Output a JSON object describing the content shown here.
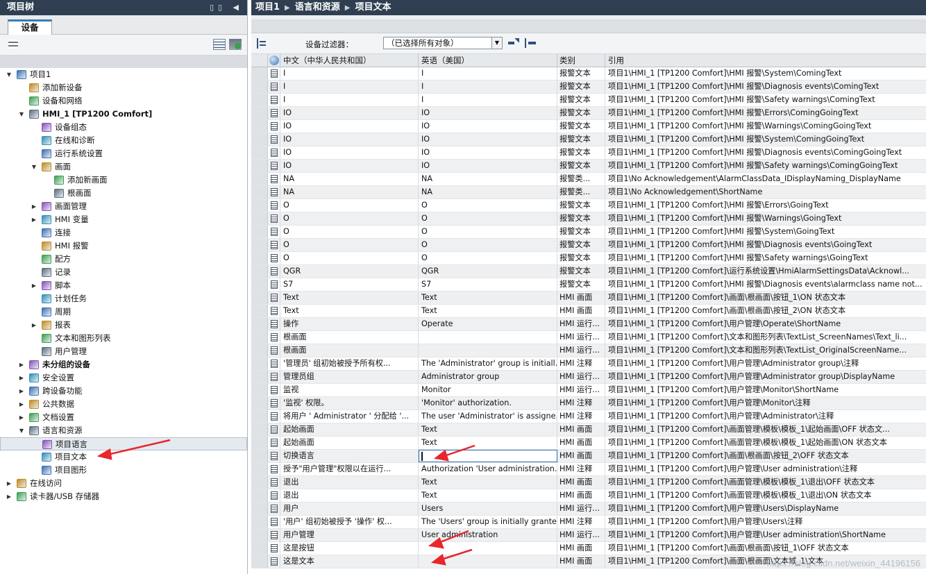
{
  "left_panel": {
    "title": "项目树",
    "tab": "设备",
    "tree": [
      {
        "label": "项目1",
        "level": 0,
        "arrow": "down",
        "icon": "project-icon",
        "bold": false
      },
      {
        "label": "添加新设备",
        "level": 1,
        "arrow": "",
        "icon": "add-device-icon",
        "bold": false
      },
      {
        "label": "设备和网络",
        "level": 1,
        "arrow": "",
        "icon": "network-icon",
        "bold": false
      },
      {
        "label": "HMI_1 [TP1200 Comfort]",
        "level": 1,
        "arrow": "down",
        "icon": "hmi-folder-icon",
        "bold": true
      },
      {
        "label": "设备组态",
        "level": 2,
        "arrow": "",
        "icon": "device-config-icon",
        "bold": false
      },
      {
        "label": "在线和诊断",
        "level": 2,
        "arrow": "",
        "icon": "online-diag-icon",
        "bold": false
      },
      {
        "label": "运行系统设置",
        "level": 2,
        "arrow": "",
        "icon": "runtime-settings-icon",
        "bold": false
      },
      {
        "label": "画面",
        "level": 2,
        "arrow": "down",
        "icon": "folder-icon",
        "bold": false
      },
      {
        "label": "添加新画面",
        "level": 3,
        "arrow": "",
        "icon": "add-screen-icon",
        "bold": false
      },
      {
        "label": "根画面",
        "level": 3,
        "arrow": "",
        "icon": "screen-icon",
        "bold": false
      },
      {
        "label": "画面管理",
        "level": 2,
        "arrow": "right",
        "icon": "screen-mgmt-icon",
        "bold": false
      },
      {
        "label": "HMI 变量",
        "level": 2,
        "arrow": "right",
        "icon": "hmi-tags-icon",
        "bold": false
      },
      {
        "label": "连接",
        "level": 2,
        "arrow": "",
        "icon": "connection-icon",
        "bold": false
      },
      {
        "label": "HMI 报警",
        "level": 2,
        "arrow": "",
        "icon": "alarm-icon",
        "bold": false
      },
      {
        "label": "配方",
        "level": 2,
        "arrow": "",
        "icon": "recipe-icon",
        "bold": false
      },
      {
        "label": "记录",
        "level": 2,
        "arrow": "",
        "icon": "log-icon",
        "bold": false
      },
      {
        "label": "脚本",
        "level": 2,
        "arrow": "right",
        "icon": "script-icon",
        "bold": false
      },
      {
        "label": "计划任务",
        "level": 2,
        "arrow": "",
        "icon": "scheduler-icon",
        "bold": false
      },
      {
        "label": "周期",
        "level": 2,
        "arrow": "",
        "icon": "cycle-icon",
        "bold": false
      },
      {
        "label": "报表",
        "level": 2,
        "arrow": "right",
        "icon": "report-icon",
        "bold": false
      },
      {
        "label": "文本和图形列表",
        "level": 2,
        "arrow": "",
        "icon": "text-graphic-list-icon",
        "bold": false
      },
      {
        "label": "用户管理",
        "level": 2,
        "arrow": "",
        "icon": "user-mgmt-icon",
        "bold": false
      },
      {
        "label": "未分组的设备",
        "level": 1,
        "arrow": "right",
        "icon": "ungrouped-devices-icon",
        "bold": true
      },
      {
        "label": "安全设置",
        "level": 1,
        "arrow": "right",
        "icon": "security-icon",
        "bold": false
      },
      {
        "label": "跨设备功能",
        "level": 1,
        "arrow": "right",
        "icon": "cross-device-icon",
        "bold": false
      },
      {
        "label": "公共数据",
        "level": 1,
        "arrow": "right",
        "icon": "common-data-icon",
        "bold": false
      },
      {
        "label": "文档设置",
        "level": 1,
        "arrow": "right",
        "icon": "doc-settings-icon",
        "bold": false
      },
      {
        "label": "语言和资源",
        "level": 1,
        "arrow": "down",
        "icon": "language-icon",
        "bold": false
      },
      {
        "label": "项目语言",
        "level": 2,
        "arrow": "",
        "icon": "project-language-icon",
        "bold": false,
        "selected": true
      },
      {
        "label": "项目文本",
        "level": 2,
        "arrow": "",
        "icon": "project-text-icon",
        "bold": false
      },
      {
        "label": "项目图形",
        "level": 2,
        "arrow": "",
        "icon": "project-graphics-icon",
        "bold": false
      },
      {
        "label": "在线访问",
        "level": 0,
        "arrow": "right",
        "icon": "online-access-icon",
        "bold": false
      },
      {
        "label": "读卡器/USB 存储器",
        "level": 0,
        "arrow": "right",
        "icon": "card-reader-icon",
        "bold": false
      }
    ]
  },
  "right_panel": {
    "breadcrumb": [
      "项目1",
      "语言和资源",
      "项目文本"
    ],
    "filter_label": "设备过滤器：",
    "filter_value": "（已选择所有对象）",
    "columns": [
      "中文（中华人民共和国）",
      "英语（美国）",
      "类别",
      "引用"
    ],
    "rows": [
      [
        "I",
        "I",
        "报警文本",
        "项目1\\HMI_1 [TP1200 Comfort]\\HMI 报警\\System\\ComingText"
      ],
      [
        "I",
        "I",
        "报警文本",
        "项目1\\HMI_1 [TP1200 Comfort]\\HMI 报警\\Diagnosis events\\ComingText"
      ],
      [
        "I",
        "I",
        "报警文本",
        "项目1\\HMI_1 [TP1200 Comfort]\\HMI 报警\\Safety warnings\\ComingText"
      ],
      [
        "IO",
        "IO",
        "报警文本",
        "项目1\\HMI_1 [TP1200 Comfort]\\HMI 报警\\Errors\\ComingGoingText"
      ],
      [
        "IO",
        "IO",
        "报警文本",
        "项目1\\HMI_1 [TP1200 Comfort]\\HMI 报警\\Warnings\\ComingGoingText"
      ],
      [
        "IO",
        "IO",
        "报警文本",
        "项目1\\HMI_1 [TP1200 Comfort]\\HMI 报警\\System\\ComingGoingText"
      ],
      [
        "IO",
        "IO",
        "报警文本",
        "项目1\\HMI_1 [TP1200 Comfort]\\HMI 报警\\Diagnosis events\\ComingGoingText"
      ],
      [
        "IO",
        "IO",
        "报警文本",
        "项目1\\HMI_1 [TP1200 Comfort]\\HMI 报警\\Safety warnings\\ComingGoingText"
      ],
      [
        "NA",
        "NA",
        "报警类...",
        "项目1\\No Acknowledgement\\AlarmClassData_IDisplayNaming_DisplayName"
      ],
      [
        "NA",
        "NA",
        "报警类...",
        "项目1\\No Acknowledgement\\ShortName"
      ],
      [
        "O",
        "O",
        "报警文本",
        "项目1\\HMI_1 [TP1200 Comfort]\\HMI 报警\\Errors\\GoingText"
      ],
      [
        "O",
        "O",
        "报警文本",
        "项目1\\HMI_1 [TP1200 Comfort]\\HMI 报警\\Warnings\\GoingText"
      ],
      [
        "O",
        "O",
        "报警文本",
        "项目1\\HMI_1 [TP1200 Comfort]\\HMI 报警\\System\\GoingText"
      ],
      [
        "O",
        "O",
        "报警文本",
        "项目1\\HMI_1 [TP1200 Comfort]\\HMI 报警\\Diagnosis events\\GoingText"
      ],
      [
        "O",
        "O",
        "报警文本",
        "项目1\\HMI_1 [TP1200 Comfort]\\HMI 报警\\Safety warnings\\GoingText"
      ],
      [
        "QGR",
        "QGR",
        "报警文本",
        "项目1\\HMI_1 [TP1200 Comfort]\\运行系统设置\\HmiAlarmSettingsData\\Acknowl..."
      ],
      [
        "S7",
        "S7",
        "报警文本",
        "项目1\\HMI_1 [TP1200 Comfort]\\HMI 报警\\Diagnosis events\\alarmclass name not..."
      ],
      [
        "Text",
        "Text",
        "HMI 画面",
        "项目1\\HMI_1 [TP1200 Comfort]\\画面\\根画面\\按钮_1\\ON 状态文本"
      ],
      [
        "Text",
        "Text",
        "HMI 画面",
        "项目1\\HMI_1 [TP1200 Comfort]\\画面\\根画面\\按钮_2\\ON 状态文本"
      ],
      [
        "操作",
        "Operate",
        "HMI 运行...",
        "项目1\\HMI_1 [TP1200 Comfort]\\用户管理\\Operate\\ShortName"
      ],
      [
        "根画面",
        "",
        "HMI 运行...",
        "项目1\\HMI_1 [TP1200 Comfort]\\文本和图形列表\\TextList_ScreenNames\\Text_li..."
      ],
      [
        "根画面",
        "",
        "HMI 运行...",
        "项目1\\HMI_1 [TP1200 Comfort]\\文本和图形列表\\TextList_OriginalScreenName..."
      ],
      [
        "'管理员' 组初始被授予所有权...",
        "The 'Administrator' group is initiall...",
        "HMI 注释",
        "项目1\\HMI_1 [TP1200 Comfort]\\用户管理\\Administrator group\\注释"
      ],
      [
        "管理员组",
        "Administrator group",
        "HMI 运行...",
        "项目1\\HMI_1 [TP1200 Comfort]\\用户管理\\Administrator group\\DisplayName"
      ],
      [
        "监视",
        "Monitor",
        "HMI 运行...",
        "项目1\\HMI_1 [TP1200 Comfort]\\用户管理\\Monitor\\ShortName"
      ],
      [
        "'监视' 权限。",
        "'Monitor' authorization.",
        "HMI 注释",
        "项目1\\HMI_1 [TP1200 Comfort]\\用户管理\\Monitor\\注释"
      ],
      [
        "将用户 ' Administrator ' 分配给 '...",
        "The user 'Administrator' is assigne...",
        "HMI 注释",
        "项目1\\HMI_1 [TP1200 Comfort]\\用户管理\\Administrator\\注释"
      ],
      [
        "起始画面",
        "Text",
        "HMI 画面",
        "项目1\\HMI_1 [TP1200 Comfort]\\画面管理\\模板\\模板_1\\起始画面\\OFF 状态文..."
      ],
      [
        "起始画面",
        "Text",
        "HMI 画面",
        "项目1\\HMI_1 [TP1200 Comfort]\\画面管理\\模板\\模板_1\\起始画面\\ON 状态文本"
      ],
      [
        "切换语言",
        "",
        "HMI 画面",
        "项目1\\HMI_1 [TP1200 Comfort]\\画面\\根画面\\按钮_2\\OFF 状态文本"
      ],
      [
        "授予\"用户管理\"权限以在运行...",
        "Authorization 'User administration...",
        "HMI 注释",
        "项目1\\HMI_1 [TP1200 Comfort]\\用户管理\\User administration\\注释"
      ],
      [
        "退出",
        "Text",
        "HMI 画面",
        "项目1\\HMI_1 [TP1200 Comfort]\\画面管理\\模板\\模板_1\\退出\\OFF 状态文本"
      ],
      [
        "退出",
        "Text",
        "HMI 画面",
        "项目1\\HMI_1 [TP1200 Comfort]\\画面管理\\模板\\模板_1\\退出\\ON 状态文本"
      ],
      [
        "用户",
        "Users",
        "HMI 运行...",
        "项目1\\HMI_1 [TP1200 Comfort]\\用户管理\\Users\\DisplayName"
      ],
      [
        "'用户' 组初始被授予 '操作' 权...",
        "The 'Users' group is initially grante...",
        "HMI 注释",
        "项目1\\HMI_1 [TP1200 Comfort]\\用户管理\\Users\\注释"
      ],
      [
        "用户管理",
        "User administration",
        "HMI 运行...",
        "项目1\\HMI_1 [TP1200 Comfort]\\用户管理\\User administration\\ShortName"
      ],
      [
        "这是按钮",
        "",
        "HMI 画面",
        "项目1\\HMI_1 [TP1200 Comfort]\\画面\\根画面\\按钮_1\\OFF 状态文本"
      ],
      [
        "这是文本",
        "",
        "HMI 画面",
        "项目1\\HMI_1 [TP1200 Comfort]\\画面\\根画面\\文本域_1\\文本"
      ]
    ],
    "editing_row_index": 29
  },
  "watermark": "https://blog.csdn.net/weixin_44196156",
  "colors": {
    "header_bg": "#2f3f51",
    "accent_blue": "#2f7fb8",
    "annotation_red": "#e8262b"
  }
}
